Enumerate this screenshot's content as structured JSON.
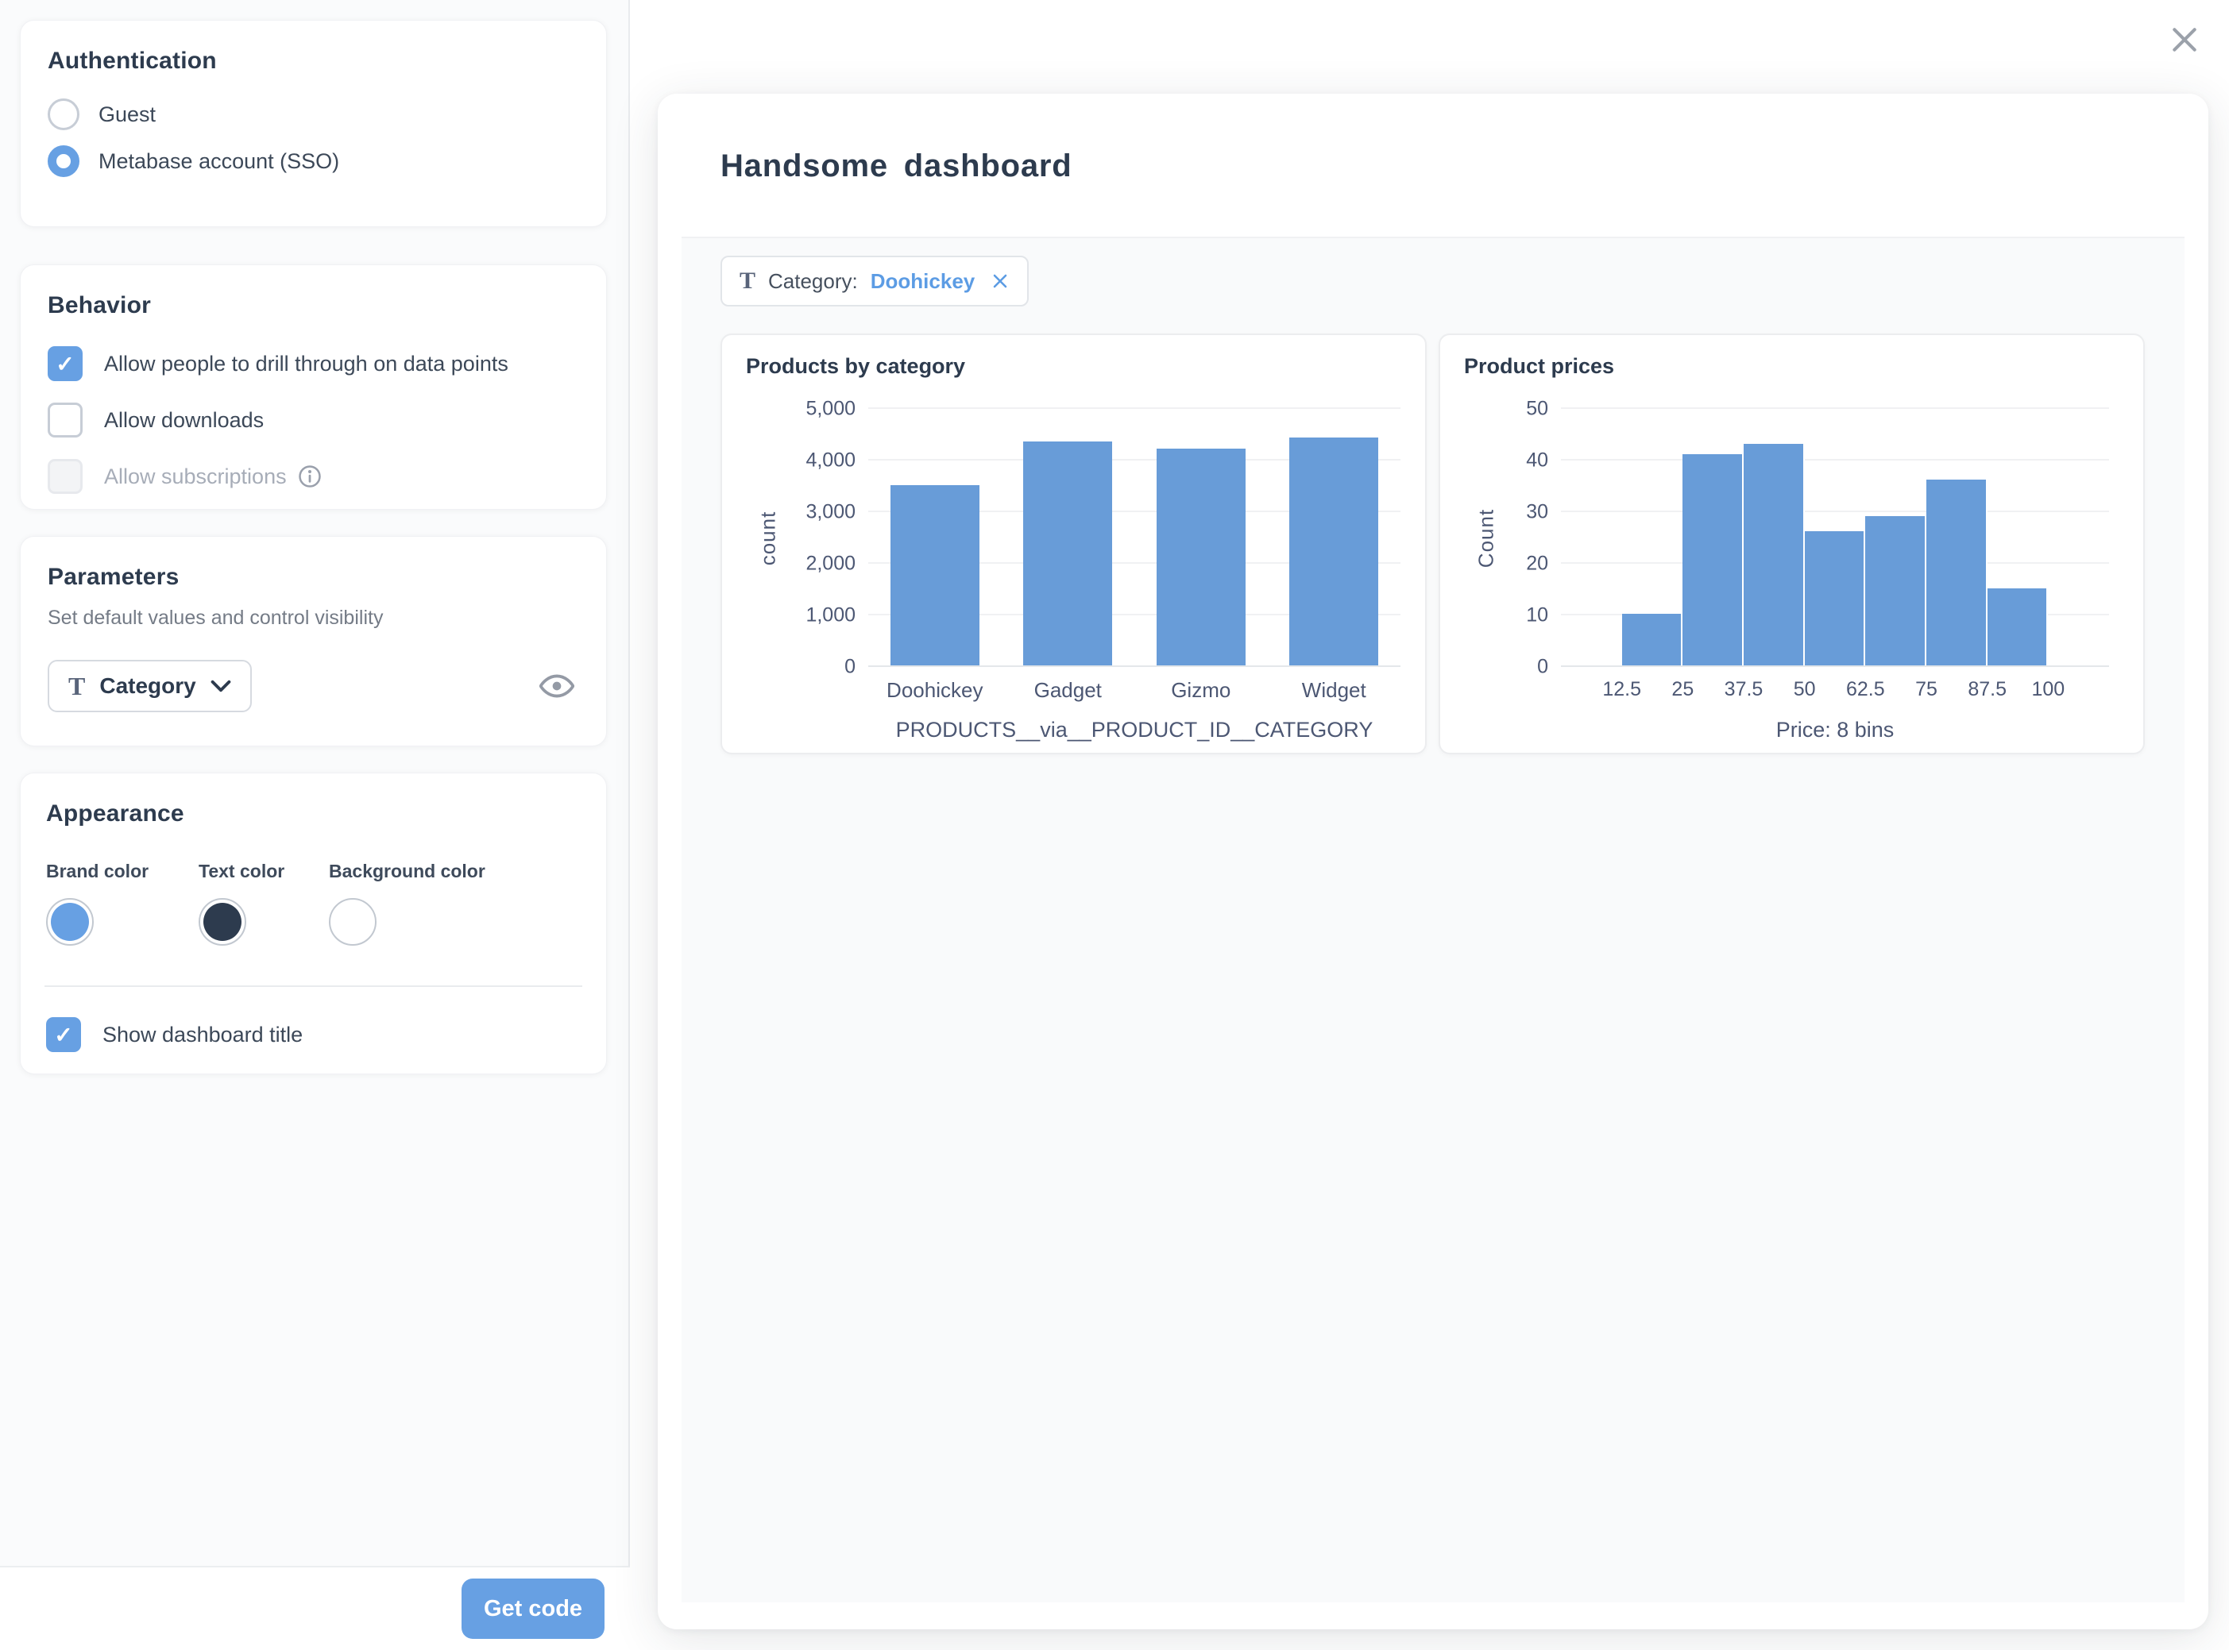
{
  "colors": {
    "ui_blue": "#67A0E3",
    "chart_bar_blue": "#689CD8",
    "text_dark": "#2D3B4E",
    "dashboard_bg": "#F9FAFB"
  },
  "panel": {
    "authentication": {
      "title": "Authentication",
      "options": [
        {
          "label": "Guest",
          "selected": false
        },
        {
          "label": "Metabase account (SSO)",
          "selected": true
        }
      ]
    },
    "behavior": {
      "title": "Behavior",
      "checkboxes": [
        {
          "label": "Allow people to drill through on data points",
          "checked": true,
          "disabled": false
        },
        {
          "label": "Allow downloads",
          "checked": false,
          "disabled": false
        },
        {
          "label": "Allow subscriptions",
          "checked": false,
          "disabled": true
        }
      ]
    },
    "parameters": {
      "title": "Parameters",
      "subtitle": "Set default values and control visibility",
      "widget": {
        "label": "Category"
      }
    },
    "appearance": {
      "title": "Appearance",
      "colors": [
        {
          "label": "Brand color",
          "value": "#67A0E3"
        },
        {
          "label": "Text color",
          "value": "#2D3B4E"
        },
        {
          "label": "Background color",
          "value": "#FFFFFF"
        }
      ],
      "show_title": {
        "label": "Show dashboard title",
        "checked": true,
        "disabled": false
      }
    },
    "footer": {
      "get_code_label": "Get code"
    }
  },
  "preview": {
    "dashboard_title": "Handsome dashboard",
    "filter_chip": {
      "label": "Category:",
      "value": "Doohickey"
    }
  },
  "chart_data": [
    {
      "type": "bar",
      "title": "Products by category",
      "categories": [
        "Doohickey",
        "Gadget",
        "Gizmo",
        "Widget"
      ],
      "values": [
        3500,
        4340,
        4200,
        4420
      ],
      "xlabel": "PRODUCTS__via__PRODUCT_ID__CATEGORY",
      "ylabel": "count",
      "ylim": [
        0,
        5000
      ],
      "yticks": [
        0,
        1000,
        2000,
        3000,
        4000,
        5000
      ],
      "ytick_labels": [
        "0",
        "1,000",
        "2,000",
        "3,000",
        "4,000",
        "5,000"
      ],
      "grid": true,
      "legend": "none",
      "bar_color": "#689CD8"
    },
    {
      "type": "histogram",
      "title": "Product prices",
      "bin_edges": [
        12.5,
        25,
        37.5,
        50,
        62.5,
        75,
        87.5,
        100
      ],
      "values": [
        10,
        41,
        43,
        26,
        29,
        36,
        15
      ],
      "xlabel": "Price: 8 bins",
      "ylabel": "Count",
      "ylim": [
        0,
        50
      ],
      "yticks": [
        0,
        10,
        20,
        30,
        40,
        50
      ],
      "ytick_labels": [
        "0",
        "10",
        "20",
        "30",
        "40",
        "50"
      ],
      "grid": true,
      "legend": "none",
      "bar_color": "#689CD8"
    }
  ]
}
